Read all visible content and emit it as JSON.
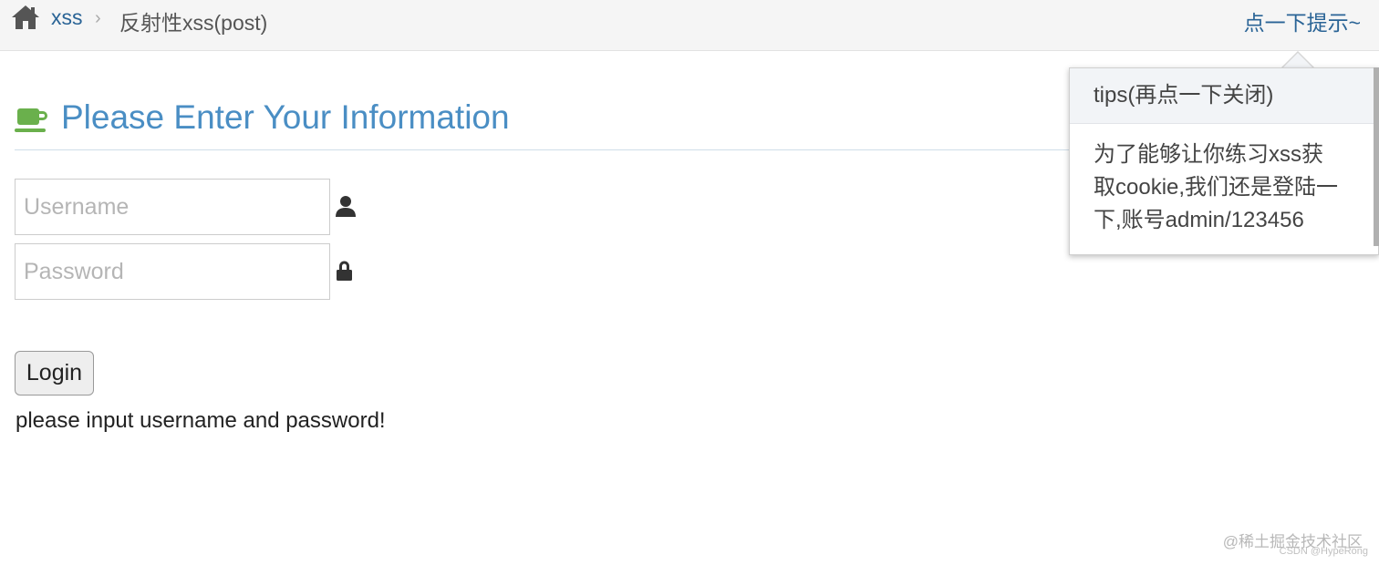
{
  "breadcrumb": {
    "home_icon": "home-icon",
    "link_label": "xss",
    "separator": "›",
    "current": "反射性xss(post)"
  },
  "hint_link": "点一下提示~",
  "header": {
    "icon": "coffee-cup-icon",
    "title": "Please Enter Your Information"
  },
  "form": {
    "username_placeholder": "Username",
    "username_value": "",
    "password_placeholder": "Password",
    "password_value": "",
    "user_icon": "user-icon",
    "lock_icon": "lock-icon",
    "login_label": "Login",
    "status_message": "please input username and password!"
  },
  "popover": {
    "title": "tips(再点一下关闭)",
    "body_lines": [
      "为了能够让你练习xss获",
      "取cookie,我们还是登陆一",
      "下,账号admin/123456"
    ]
  },
  "watermark": {
    "line1": "@稀土掘金技术社区",
    "line2": "CSDN @HypeRong"
  },
  "colors": {
    "link": "#2a6496",
    "title": "#4a8ec4",
    "cup": "#6ab04c",
    "topbar_bg": "#f5f5f5"
  }
}
